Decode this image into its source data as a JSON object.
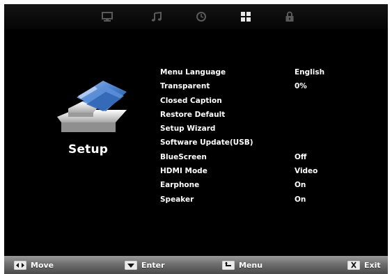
{
  "top_tabs": [
    {
      "icon": "monitor-icon",
      "active": false
    },
    {
      "icon": "music-note-icon",
      "active": false
    },
    {
      "icon": "clock-icon",
      "active": false
    },
    {
      "icon": "grid-icon",
      "active": true
    },
    {
      "icon": "lock-icon",
      "active": false
    }
  ],
  "setup": {
    "title": "Setup",
    "graphic": "setup-folder-icon"
  },
  "menu": [
    {
      "label": "Menu Language",
      "value": "English"
    },
    {
      "label": "Transparent",
      "value": "0%"
    },
    {
      "label": "Closed Caption",
      "value": ""
    },
    {
      "label": "Restore Default",
      "value": ""
    },
    {
      "label": "Setup Wizard",
      "value": ""
    },
    {
      "label": "Software Update(USB)",
      "value": ""
    },
    {
      "label": "BlueScreen",
      "value": "Off"
    },
    {
      "label": "HDMI Mode",
      "value": "Video"
    },
    {
      "label": "Earphone",
      "value": "On"
    },
    {
      "label": "Speaker",
      "value": "On"
    }
  ],
  "footer": {
    "move": {
      "label": "Move",
      "icon": "left-right-arrows-icon"
    },
    "enter": {
      "label": "Enter",
      "icon": "down-arrow-icon"
    },
    "menu": {
      "label": "Menu",
      "icon": "return-arrow-icon"
    },
    "exit": {
      "label": "Exit",
      "icon": "exit-x-icon"
    }
  },
  "colors": {
    "background": "#000000",
    "text": "#ffffff",
    "active_tab": "#e8e8e8",
    "inactive_tab": "#5a5a5a",
    "accent_blue": "#3f77c7"
  }
}
